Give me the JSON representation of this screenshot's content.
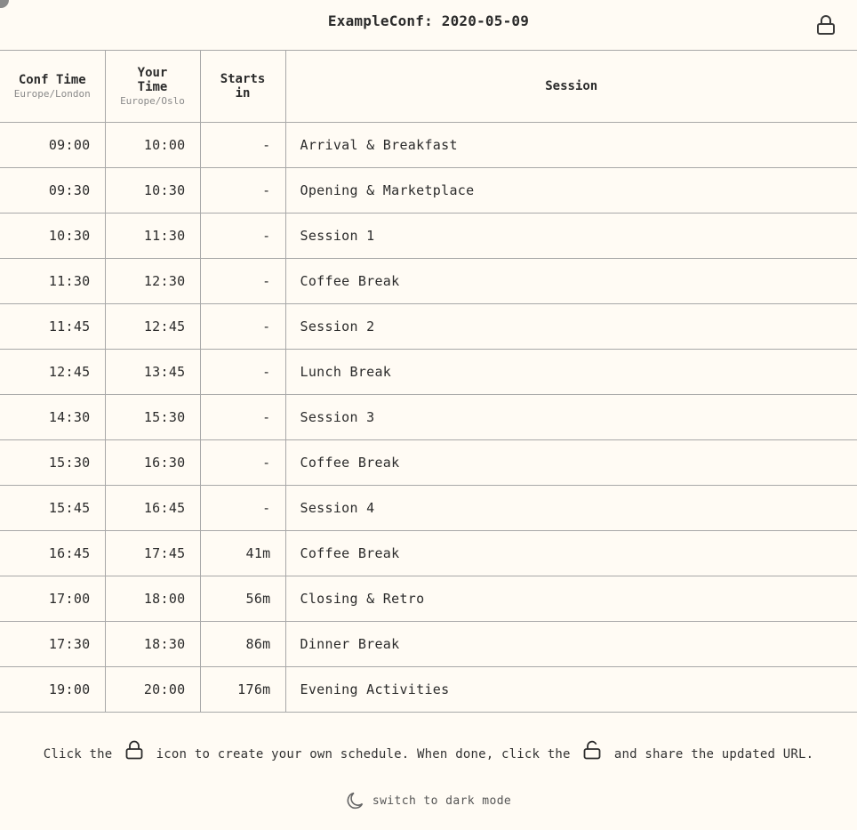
{
  "header": {
    "title": "ExampleConf: 2020-05-09",
    "lock_icon": "lock-icon"
  },
  "table": {
    "columns": {
      "conf_time": {
        "label": "Conf Time",
        "tz": "Europe/London"
      },
      "your_time": {
        "label_line1": "Your",
        "label_line2": "Time",
        "tz": "Europe/Oslo"
      },
      "starts_in": {
        "label_line1": "Starts",
        "label_line2": "in"
      },
      "session": {
        "label": "Session"
      }
    },
    "rows": [
      {
        "conf": "09:00",
        "yours": "10:00",
        "starts": "-",
        "session": "Arrival & Breakfast"
      },
      {
        "conf": "09:30",
        "yours": "10:30",
        "starts": "-",
        "session": "Opening & Marketplace"
      },
      {
        "conf": "10:30",
        "yours": "11:30",
        "starts": "-",
        "session": "Session 1"
      },
      {
        "conf": "11:30",
        "yours": "12:30",
        "starts": "-",
        "session": "Coffee Break"
      },
      {
        "conf": "11:45",
        "yours": "12:45",
        "starts": "-",
        "session": "Session 2"
      },
      {
        "conf": "12:45",
        "yours": "13:45",
        "starts": "-",
        "session": "Lunch Break"
      },
      {
        "conf": "14:30",
        "yours": "15:30",
        "starts": "-",
        "session": "Session 3"
      },
      {
        "conf": "15:30",
        "yours": "16:30",
        "starts": "-",
        "session": "Coffee Break"
      },
      {
        "conf": "15:45",
        "yours": "16:45",
        "starts": "-",
        "session": "Session 4"
      },
      {
        "conf": "16:45",
        "yours": "17:45",
        "starts": "41m",
        "session": "Coffee Break"
      },
      {
        "conf": "17:00",
        "yours": "18:00",
        "starts": "56m",
        "session": "Closing & Retro"
      },
      {
        "conf": "17:30",
        "yours": "18:30",
        "starts": "86m",
        "session": "Dinner Break"
      },
      {
        "conf": "19:00",
        "yours": "20:00",
        "starts": "176m",
        "session": "Evening Activities"
      }
    ]
  },
  "footer": {
    "hint_part1": "Click the",
    "hint_part2": "icon to create your own schedule. When done, click the",
    "hint_part3": "and share the updated URL.",
    "hint_icon_1": "lock-icon",
    "hint_icon_2": "unlock-icon",
    "dark_mode_label": "switch to dark mode",
    "dark_mode_icon": "moon-icon"
  },
  "colors": {
    "background": "#fffbf4",
    "text": "#2b2b2b",
    "border": "#a8a8a8",
    "muted": "#8a8a8a"
  }
}
